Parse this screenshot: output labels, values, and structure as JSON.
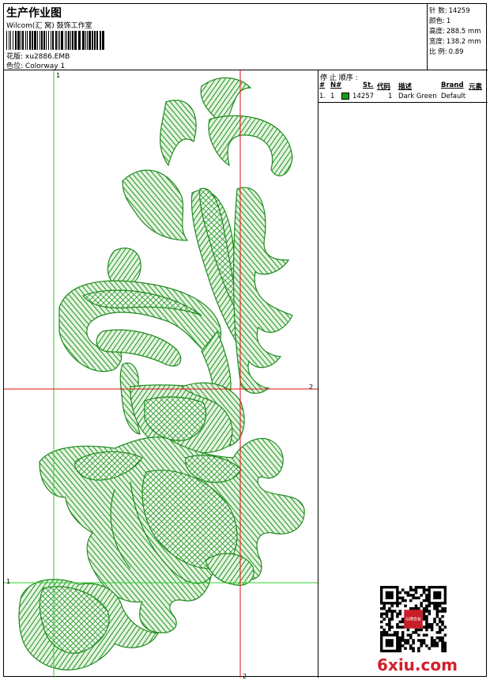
{
  "header": {
    "title": "生产作业图",
    "company": "Wilcom(汇 窝) 鼓饰工作室",
    "design_label": "花版:",
    "design_value": "xu2886.EMB",
    "colorway_label": "色位:",
    "colorway_value": "Colorway 1"
  },
  "stats": [
    {
      "label": "针 数:",
      "value": "14259"
    },
    {
      "label": "颜色:",
      "value": "1"
    },
    {
      "label": "高度:",
      "value": "288.5 mm"
    },
    {
      "label": "宽度:",
      "value": "138.2 mm"
    },
    {
      "label": "比 例:",
      "value": "0.89"
    }
  ],
  "stop_sequence": {
    "title": "停 止 顺序 :",
    "columns": [
      "#",
      "N#",
      "St.",
      "代码",
      "描述",
      "Brand",
      "元素"
    ],
    "rows": [
      {
        "index": "1.",
        "n": "1",
        "color": "#1a9a1a",
        "stitches": "14257",
        "code": "1",
        "description": "Dark Green",
        "brand": "Default",
        "element": ""
      }
    ]
  },
  "guides": {
    "top_label": "1",
    "left_label": "1",
    "right_label": "2",
    "bottom_label": "2"
  },
  "embroidery_color": "#2a9a2a",
  "watermark": "6xiu.com",
  "qr_badge_text": "以绣会友"
}
